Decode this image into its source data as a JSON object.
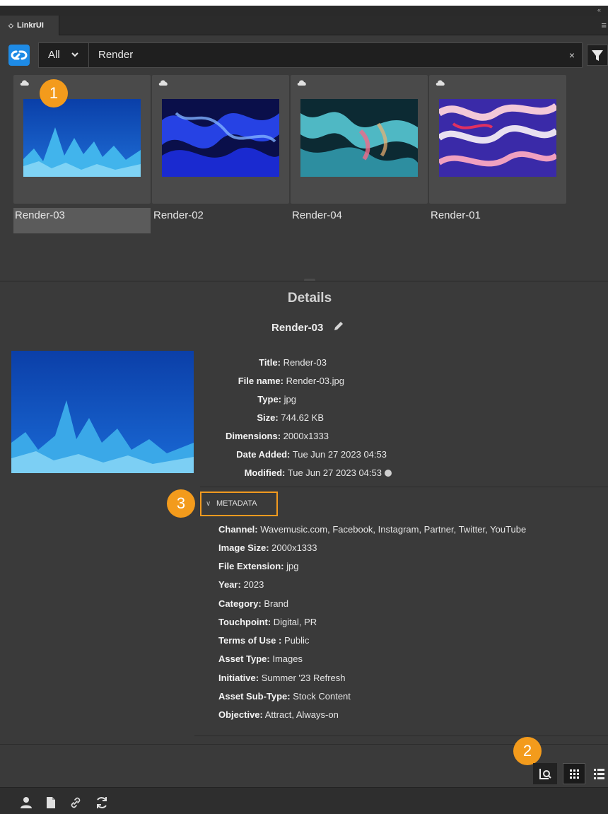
{
  "window": {
    "tab_label": "LinkrUI",
    "collapse_glyph": "«",
    "tab_glyph": "◇",
    "menu_glyph": "≡"
  },
  "search": {
    "scope_value": "All",
    "query": "Render",
    "clear_glyph": "×"
  },
  "thumbnails": [
    {
      "label": "Render-03",
      "selected": true
    },
    {
      "label": "Render-02",
      "selected": false
    },
    {
      "label": "Render-04",
      "selected": false
    },
    {
      "label": "Render-01",
      "selected": false
    }
  ],
  "details": {
    "heading": "Details",
    "asset_name": "Render-03",
    "fields": [
      {
        "key": "Title:",
        "value": "Render-03"
      },
      {
        "key": "File name:",
        "value": "Render-03.jpg"
      },
      {
        "key": "Type:",
        "value": "jpg"
      },
      {
        "key": "Size:",
        "value": "744.62 KB"
      },
      {
        "key": "Dimensions:",
        "value": "2000x1333"
      },
      {
        "key": "Date Added:",
        "value": "Tue Jun 27 2023 04:53"
      },
      {
        "key": "Modified:",
        "value": "Tue Jun 27 2023 04:53"
      }
    ]
  },
  "metadata": {
    "toggle_label": "METADATA",
    "chevron_glyph": "∨",
    "fields": [
      {
        "key": "Channel:",
        "value": "Wavemusic.com, Facebook, Instagram, Partner, Twitter, YouTube"
      },
      {
        "key": "Image Size:",
        "value": "2000x1333"
      },
      {
        "key": "File Extension:",
        "value": "jpg"
      },
      {
        "key": "Year:",
        "value": "2023"
      },
      {
        "key": "Category:",
        "value": "Brand"
      },
      {
        "key": "Touchpoint:",
        "value": "Digital, PR"
      },
      {
        "key": "Terms of Use :",
        "value": "Public"
      },
      {
        "key": "Asset Type:",
        "value": "Images"
      },
      {
        "key": "Initiative:",
        "value": "Summer '23 Refresh"
      },
      {
        "key": "Asset Sub-Type:",
        "value": "Stock Content"
      },
      {
        "key": "Objective:",
        "value": "Attract, Always-on"
      }
    ]
  },
  "callouts": [
    "1",
    "2",
    "3"
  ],
  "icons": {
    "logo": "linkr-logo-icon",
    "funnel": "filter-funnel-icon",
    "cloud": "cloud-icon",
    "pencil": "pencil-icon",
    "preview_toggle": "preview-toggle-icon",
    "grid_view": "grid-view-icon",
    "list_view": "list-view-icon",
    "user": "user-icon",
    "document": "document-icon",
    "link": "link-icon",
    "refresh": "refresh-icon"
  },
  "colors": {
    "panel_bg": "#3a3a3a",
    "accent_blue": "#1e8be6",
    "callout_orange": "#f39b1c"
  }
}
